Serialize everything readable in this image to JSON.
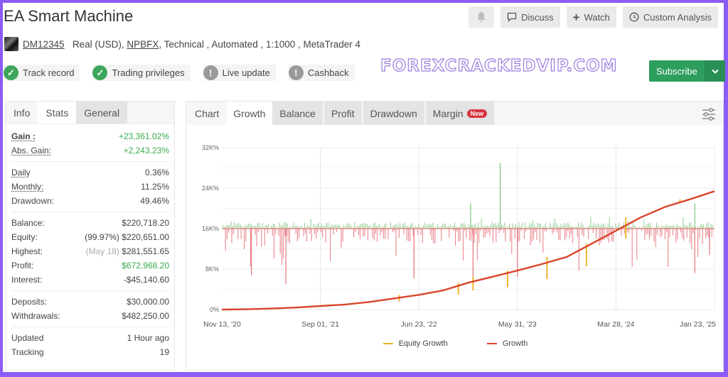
{
  "header": {
    "title": "EA Smart Machine",
    "account_id": "DM12345",
    "account_type": "Real (USD),",
    "broker": "NPBFX",
    "attributes": " , Technical , Automated , 1:1000 , MetaTrader 4"
  },
  "badges": [
    {
      "label": "Track record",
      "status": "verified",
      "icon": "check-icon"
    },
    {
      "label": "Trading privileges",
      "status": "verified",
      "icon": "check-icon"
    },
    {
      "label": "Live update",
      "status": "unverified",
      "icon": "exclamation-icon"
    },
    {
      "label": "Cashback",
      "status": "unverified",
      "icon": "exclamation-icon"
    }
  ],
  "toolbar": {
    "bell_icon": "bell-icon",
    "discuss_label": "Discuss",
    "watch_label": "Watch",
    "custom_analysis_label": "Custom Analysis",
    "subscribe_label": "Subscribe"
  },
  "watermark": "FOREXCRACKEDVIP.COM",
  "stats_panel": {
    "tabs": [
      "Info",
      "Stats",
      "General"
    ],
    "active_tab": "Stats",
    "gain_label": "Gain :",
    "gain_value": "+23,361.02%",
    "abs_gain_label": "Abs. Gain:",
    "abs_gain_value": "+2,243.23%",
    "daily_label": "Daily",
    "daily_value": "0.36%",
    "monthly_label": "Monthly:",
    "monthly_value": "11.25%",
    "drawdown_label": "Drawdown:",
    "drawdown_value": "49.46%",
    "balance_label": "Balance:",
    "balance_value": "$220,718.20",
    "equity_label": "Equity:",
    "equity_pct": "(99.97%)",
    "equity_value": "$220,651.00",
    "highest_label": "Highest:",
    "highest_date": "(May 18)",
    "highest_value": "$281,551.65",
    "profit_label": "Profit:",
    "profit_value": "$672,968.20",
    "interest_label": "Interest:",
    "interest_value": "-$45,140.60",
    "deposits_label": "Deposits:",
    "deposits_value": "$30,000.00",
    "withdrawals_label": "Withdrawals:",
    "withdrawals_value": "$482,250.00",
    "updated_label": "Updated",
    "updated_value": "1 Hour ago",
    "tracking_label": "Tracking",
    "tracking_value": "19"
  },
  "chart_panel": {
    "tabs": [
      "Chart",
      "Growth",
      "Balance",
      "Profit",
      "Drawdown",
      "Margin"
    ],
    "active_tab": "Growth",
    "new_badge": "New",
    "settings_icon": "sliders-icon"
  },
  "chart_data": {
    "type": "line",
    "title": "Growth",
    "xlabel": "",
    "ylabel": "",
    "y_ticks": [
      "0%",
      "8K%",
      "16K%",
      "24K%",
      "32K%"
    ],
    "ylim": [
      0,
      32000
    ],
    "x_ticks": [
      "Nov 13, '20",
      "Sep 01, '21",
      "Jun 23, '22",
      "May 31, '23",
      "Mar 28, '24",
      "Jan 23, '25"
    ],
    "grid": true,
    "legend": {
      "position": "bottom",
      "entries": [
        "Equity Growth",
        "Growth"
      ]
    },
    "colors": {
      "growth": "#d9442b",
      "equity": "#f0b429",
      "profit_bar": "#7cc47a",
      "loss_bar": "#e8727a"
    },
    "series": [
      {
        "name": "Growth",
        "x_fraction": [
          0,
          0.05,
          0.1,
          0.15,
          0.2,
          0.25,
          0.3,
          0.35,
          0.4,
          0.45,
          0.5,
          0.55,
          0.6,
          0.65,
          0.7,
          0.75,
          0.8,
          0.85,
          0.9,
          0.95,
          1.0
        ],
        "values": [
          0,
          60,
          200,
          400,
          700,
          1000,
          1500,
          2200,
          2900,
          3800,
          5300,
          6500,
          7700,
          9000,
          10400,
          13000,
          15600,
          18200,
          20300,
          21800,
          23400
        ]
      },
      {
        "name": "Equity Growth",
        "x_fraction": [
          0.36,
          0.48,
          0.51,
          0.58,
          0.66,
          0.74,
          0.82,
          0.93
        ],
        "values": [
          1600,
          3000,
          3800,
          4400,
          6000,
          8600,
          14200,
          21000
        ]
      }
    ],
    "bars_baseline": 16000,
    "bars_note": "Daily profit (green, above 16K% baseline) and loss (red, below baseline) bars; notable spikes: green ~21K% near Feb '23 and ~29K% near Apr '23"
  }
}
